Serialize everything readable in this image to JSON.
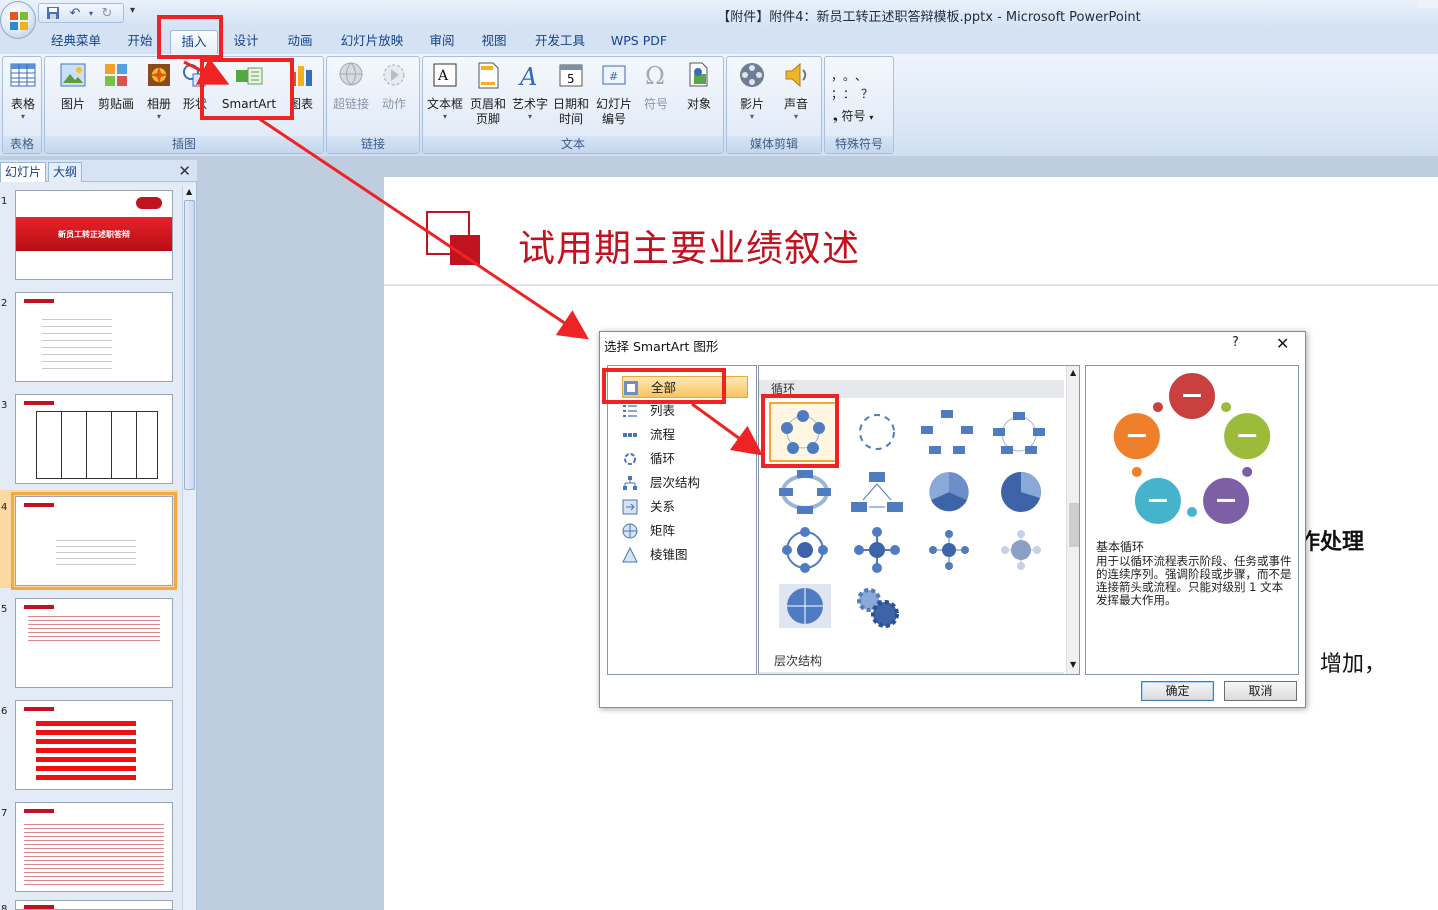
{
  "window": {
    "title": "【附件】附件4：新员工转正述职答辩模板.pptx - Microsoft PowerPoint"
  },
  "tabs": [
    "经典菜单",
    "开始",
    "插入",
    "设计",
    "动画",
    "幻灯片放映",
    "审阅",
    "视图",
    "开发工具",
    "WPS PDF"
  ],
  "active_tab": "插入",
  "ribbon": {
    "groups": {
      "tables": "表格",
      "illustrations": "插图",
      "links": "链接",
      "text": "文本",
      "media": "媒体剪辑",
      "symbols": "特殊符号"
    },
    "buttons": {
      "table": "表格",
      "picture": "图片",
      "clipart": "剪贴画",
      "album": "相册",
      "shapes": "形状",
      "smartart": "SmartArt",
      "chart": "图表",
      "hyperlink": "超链接",
      "action": "动作",
      "textbox": "文本框",
      "header1": "页眉和",
      "header2": "页脚",
      "wordart": "艺术字",
      "datetime1": "日期和",
      "datetime2": "时间",
      "slidenum1": "幻灯片",
      "slidenum2": "编号",
      "symbol": "符号",
      "object": "对象",
      "movie": "影片",
      "sound": "声音",
      "special_symbol": "符号"
    },
    "symbol_glyphs": [
      "，",
      "。",
      "、",
      "；",
      "：",
      "？"
    ]
  },
  "pane": {
    "tab_slides": "幻灯片",
    "tab_outline": "大纲",
    "slide_numbers": [
      "1",
      "2",
      "3",
      "4",
      "5",
      "6",
      "7",
      "8"
    ],
    "selected_slide": 4,
    "slide1_title": "新员工转正述职答辩"
  },
  "slide": {
    "title": "试用期主要业绩叙述",
    "fragment1": "作处理",
    "fragment2": "增加，"
  },
  "dialog": {
    "title": "选择 SmartArt 图形",
    "help": "?",
    "close": "✕",
    "categories": [
      "全部",
      "列表",
      "流程",
      "循环",
      "层次结构",
      "关系",
      "矩阵",
      "棱锥图"
    ],
    "selected_category": "全部",
    "section_cycle": "循环",
    "section_hierarchy": "层次结构",
    "preview_name": "基本循环",
    "preview_desc": "用于以循环流程表示阶段、任务或事件的连续序列。强调阶段或步骤，而不是连接箭头或流程。只能对级别 1 文本发挥最大作用。",
    "ok": "确定",
    "cancel": "取消",
    "preview_colors": [
      "#c9403e",
      "#9bbb3b",
      "#7d5fa6",
      "#45b3cc",
      "#ef7f2b"
    ]
  },
  "accent": {
    "red": "#ee2323",
    "title_red": "#c1121f"
  }
}
